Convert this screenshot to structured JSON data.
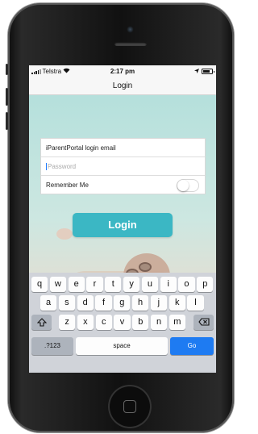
{
  "status": {
    "carrier": "Telstra",
    "time": "2:17 pm",
    "location_icon": "location-arrow-icon"
  },
  "nav": {
    "title": "Login"
  },
  "form": {
    "email_value": "iParentPortal login email",
    "password_placeholder": "Password",
    "remember_label": "Remember Me",
    "remember_on": false
  },
  "login_button": "Login",
  "keyboard": {
    "row1": [
      "q",
      "w",
      "e",
      "r",
      "t",
      "y",
      "u",
      "i",
      "o",
      "p"
    ],
    "row2": [
      "a",
      "s",
      "d",
      "f",
      "g",
      "h",
      "j",
      "k",
      "l"
    ],
    "row3": [
      "z",
      "x",
      "c",
      "v",
      "b",
      "n",
      "m"
    ],
    "numbers_label": ".?123",
    "space_label": "space",
    "go_label": "Go"
  },
  "colors": {
    "accent": "#3bb7c4",
    "go_key": "#1e7bf2"
  }
}
